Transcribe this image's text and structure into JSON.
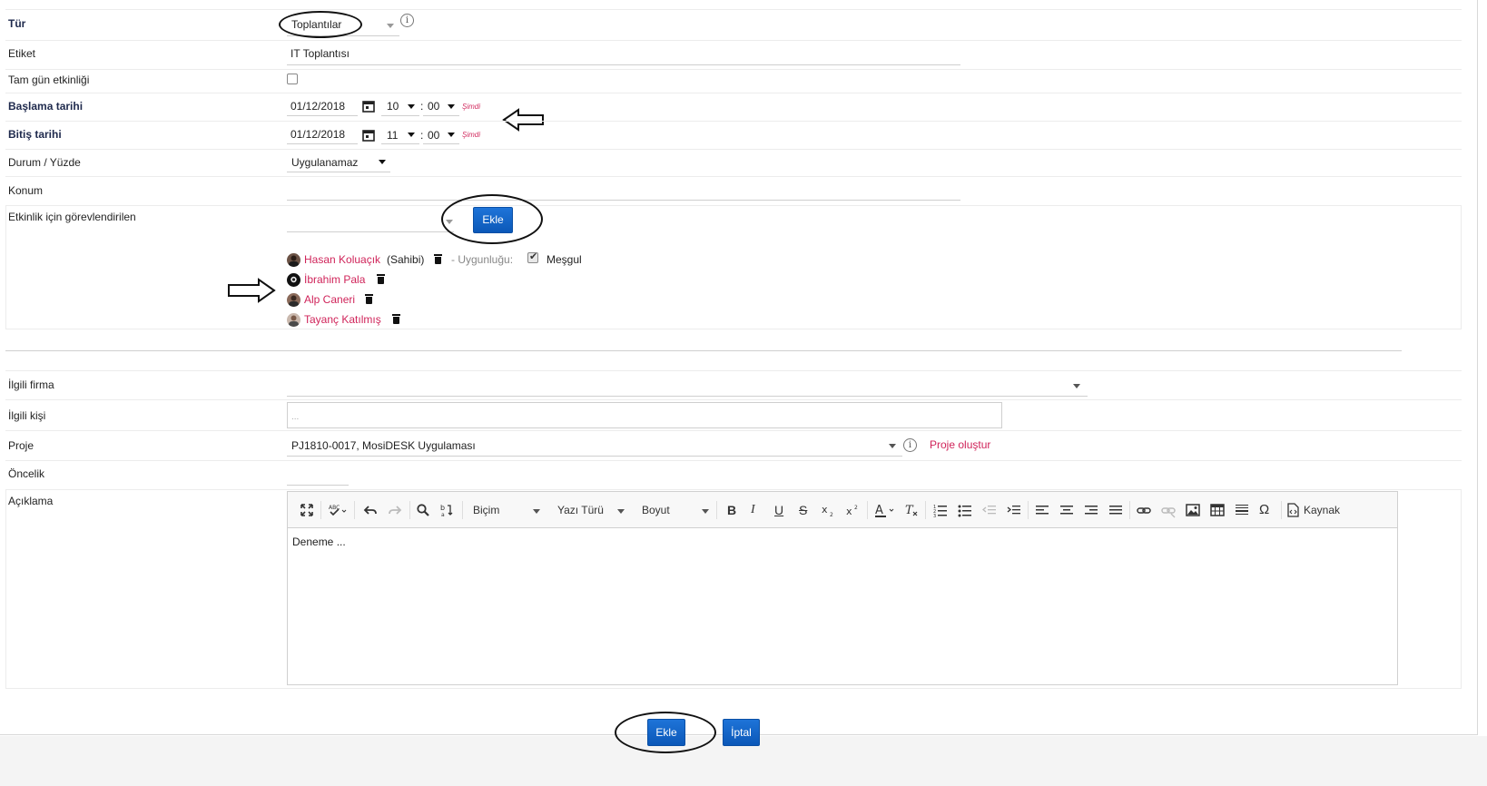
{
  "form": {
    "type_label": "Tür",
    "type_value": "Toplantılar",
    "tag_label": "Etiket",
    "tag_value": "IT Toplantısı",
    "allday_label": "Tam gün etkinliği",
    "start_label": "Başlama tarihi",
    "start_date": "01/12/2018",
    "start_hour": "10",
    "start_min": "00",
    "end_label": "Bitiş tarihi",
    "end_date": "01/12/2018",
    "end_hour": "11",
    "end_min": "00",
    "now_link": "Şimdi",
    "time_sep": ":",
    "status_label": "Durum / Yüzde",
    "status_value": "Uygulanamaz",
    "location_label": "Konum",
    "assigned_label": "Etkinlik için görevlendirilen",
    "add_button": "Ekle",
    "availability_prefix": "- Uygunluğu:",
    "availability_value": "Meşgul",
    "owner_suffix": "(Sahibi)",
    "assignees": [
      {
        "name": "Hasan Koluaçık"
      },
      {
        "name": "İbrahim Pala"
      },
      {
        "name": "Alp Caneri"
      },
      {
        "name": "Tayanç Katılmış"
      }
    ],
    "company_label": "İlgili firma",
    "contact_label": "İlgili kişi",
    "contact_placeholder": "...",
    "project_label": "Proje",
    "project_value": "PJ1810-0017, MosiDESK Uygulaması",
    "create_project_link": "Proje oluştur",
    "priority_label": "Öncelik",
    "description_label": "Açıklama",
    "description_value": "Deneme ..."
  },
  "editor": {
    "format_label": "Biçim",
    "font_label": "Yazı Türü",
    "size_label": "Boyut",
    "source_label": "Kaynak",
    "bold": "B",
    "italic": "I",
    "underline": "U",
    "strike": "S",
    "omega": "Ω"
  },
  "footer": {
    "add_button": "Ekle",
    "cancel_button": "İptal"
  },
  "colors": {
    "accent": "#0b58b8",
    "link": "#d0245a",
    "label_bold": "#1f2a4d"
  }
}
